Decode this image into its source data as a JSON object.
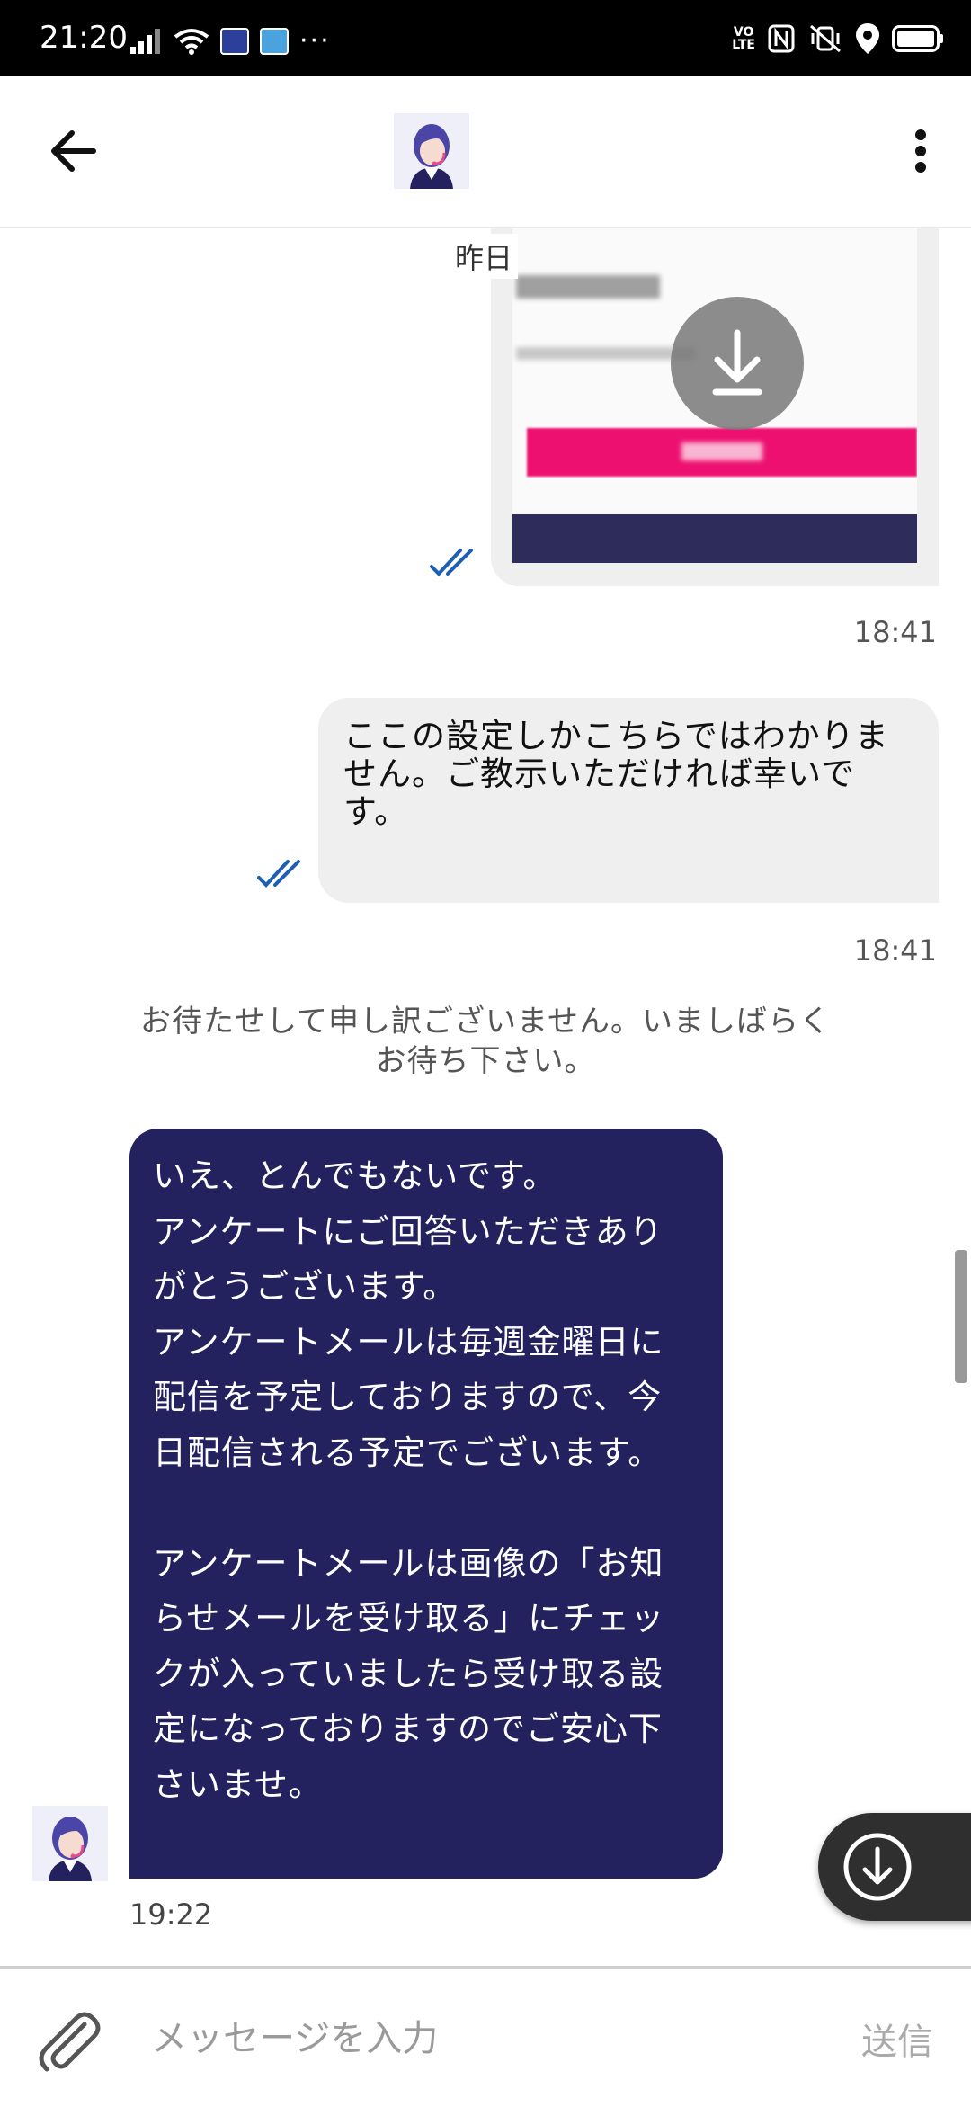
{
  "status_bar": {
    "time": "21:20",
    "overflow_dots": "···",
    "volte_top": "VO",
    "volte_bottom": "LTE"
  },
  "header": {
    "back_icon": "arrow-left-icon",
    "avatar_icon": "support-operator-avatar",
    "menu_icon": "more-vertical-icon"
  },
  "chat": {
    "date_separator": "昨日",
    "messages": [
      {
        "type": "image",
        "direction": "outgoing",
        "time": "18:41",
        "read": true
      },
      {
        "type": "text",
        "direction": "outgoing",
        "text": "ここの設定しかこちらではわかりません。ご教示いただければ幸いです。",
        "time": "18:41",
        "read": true
      },
      {
        "type": "system",
        "text": "お待たせして申し訳ございません。いましばらくお待ち下さい。"
      },
      {
        "type": "text",
        "direction": "incoming",
        "text": "いえ、とんでもないです。\nアンケートにご回答いただきありがとうございます。\nアンケートメールは毎週金曜日に配信を予定しておりますので、今日配信される予定でございます。\n\nアンケートメールは画像の「お知らせメールを受け取る」にチェックが入っていましたら受け取る設定になっておりますのでご安心下さいませ。",
        "time": "19:22"
      }
    ]
  },
  "input_bar": {
    "placeholder": "メッセージを入力",
    "send_label": "送信",
    "attach_icon": "paperclip-icon"
  },
  "colors": {
    "incoming_bubble": "#24225e",
    "outgoing_bubble": "#efefef",
    "read_ticks": "#1e5fb3"
  }
}
